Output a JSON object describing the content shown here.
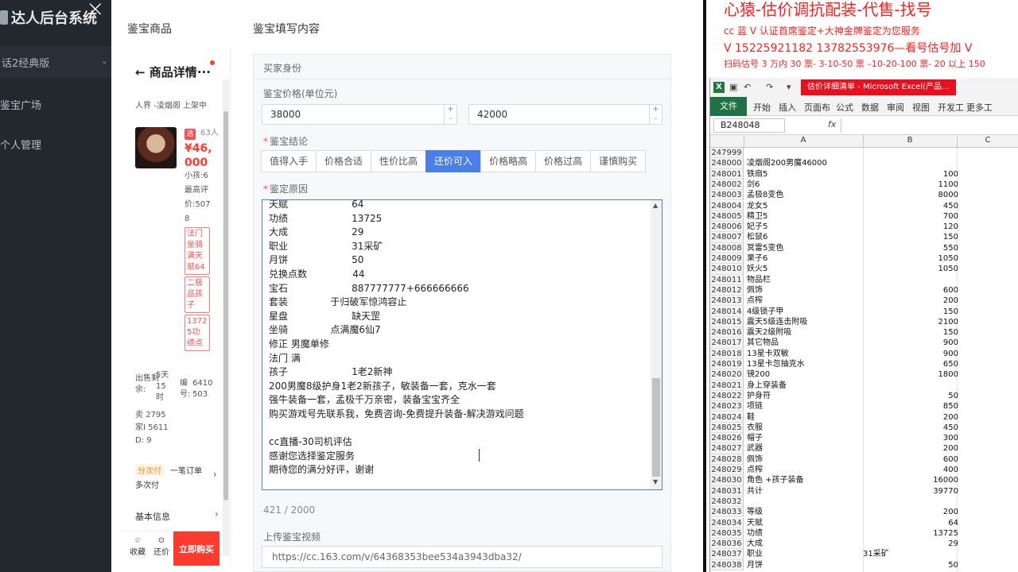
{
  "admin": {
    "logo": "达人后台系统",
    "menu_selected": "话2经典版",
    "nav": [
      "鉴宝广场",
      "个人管理"
    ]
  },
  "modal": {
    "header_left": "鉴宝商品",
    "header_right": "鉴宝填写内容"
  },
  "product": {
    "title": "商品详情",
    "title_more": "···",
    "server": "人界 -凌烟阁",
    "status": "上架中",
    "badge": "选",
    "people": "63人",
    "price_line1": "¥46,",
    "price_line2": "000",
    "meta1": "小孩:6",
    "meta2": "最高评",
    "meta3": "价:507",
    "meta4": "8",
    "pills": [
      "法门坐骑满天赋64",
      "二极品孩子",
      "13725功绩点"
    ],
    "sale_label": "出售剩余:",
    "sale_value": "5天15时",
    "code_label": "编号:",
    "code_value": "6410503",
    "stats_line1": "卖",
    "stats_line1b": "2795",
    "stats_line2": "家I",
    "stats_line2b": "5611",
    "stats_line3": "D:",
    "stats_line3b": "9",
    "pay_tag": "分次付",
    "pay_text": "一笔订单",
    "pay_text2": "多次付",
    "basic_info": "基本信息",
    "fav": "收藏",
    "bargain": "还价",
    "buy": "立即购买"
  },
  "form": {
    "section_title": "买家身份",
    "price_label": "鉴宝价格(单位元)",
    "price_min": "38000",
    "price_max": "42000",
    "conclusion_label": "鉴宝结论",
    "options": [
      "值得入手",
      "价格合适",
      "性价比高",
      "还价可入",
      "价格略高",
      "价格过高",
      "谨慎购买"
    ],
    "active_option": 3,
    "reason_label": "鉴定原因",
    "reason_lines": [
      "天赋                     64",
      "功绩                     13725",
      "大成                     29",
      "职业                     31采矿",
      "月饼                     50",
      "兑换点数               44",
      "宝石                     887777777+666666666",
      "套装              于归破军惊鸿容止",
      "星盘                     缺天罡",
      "坐骑              点满魔6仙7",
      "修正 男魔单修",
      "法门 满",
      "孩子                     1老2新神",
      "200男魔8级护身1老2新孩子，敏装备一套，克水一套",
      "强牛装备一套，孟极千万亲密，装备宝宝齐全",
      "购买游戏号先联系我，免费咨询-免费提升装备-解决游戏问题",
      "",
      "cc直播-30司机评估",
      "感谢您选择鉴定服务",
      "期待您的满分好评，谢谢"
    ],
    "counter": "421 / 2000",
    "video_label": "上传鉴宝视频",
    "video_url": "https://cc.163.com/v/64368353bee534a3943dba32/"
  },
  "promo": {
    "line1": "心猿-估价调抗配装-代售-找号",
    "line2": "cc 蓝 V 认证首席鉴定+大神金牌鉴定为您服务",
    "line3": "V 15225921182      13782553976—看号估号加 V",
    "line4": "扫码估号 3 万内 30 票- 3-10-50 票  –10-20-100 票- 20 以上 150"
  },
  "excel": {
    "doc_title": "估价详细清单 - Microsoft Excel(产品...",
    "tabs": [
      "文件",
      "开始",
      "插入",
      "页面布",
      "公式",
      "数据",
      "审阅",
      "视图",
      "开发工",
      "更多工"
    ],
    "namebox": "B248048",
    "fx": "fx",
    "columns": [
      "A",
      "B",
      "C"
    ],
    "rows": [
      {
        "n": "247999",
        "a": "",
        "b": ""
      },
      {
        "n": "248000",
        "a": "凌烟阁200男魔46000",
        "b": ""
      },
      {
        "n": "248001",
        "a": "铁扇5",
        "b": "100"
      },
      {
        "n": "248002",
        "a": "剑6",
        "b": "1100"
      },
      {
        "n": "248003",
        "a": "孟极8变色",
        "b": "8000"
      },
      {
        "n": "248004",
        "a": "龙女5",
        "b": "450"
      },
      {
        "n": "248005",
        "a": "精卫5",
        "b": "700"
      },
      {
        "n": "248006",
        "a": "妃子5",
        "b": "120"
      },
      {
        "n": "248007",
        "a": "松鼠6",
        "b": "150"
      },
      {
        "n": "248008",
        "a": "冥雷5变色",
        "b": "550"
      },
      {
        "n": "248009",
        "a": "果子6",
        "b": "1050"
      },
      {
        "n": "248010",
        "a": "妖火5",
        "b": "1050"
      },
      {
        "n": "248011",
        "a": "物品栏",
        "b": ""
      },
      {
        "n": "248012",
        "a": "佩饰",
        "b": "600"
      },
      {
        "n": "248013",
        "a": "点榨",
        "b": "200"
      },
      {
        "n": "248014",
        "a": "4级锁子甲",
        "b": "150"
      },
      {
        "n": "248015",
        "a": "震天5级连击附吸",
        "b": "2100"
      },
      {
        "n": "248016",
        "a": "震天2级附吸",
        "b": "150"
      },
      {
        "n": "248017",
        "a": "其它物品",
        "b": "900"
      },
      {
        "n": "248018",
        "a": "13星卡双敏",
        "b": "900"
      },
      {
        "n": "248019",
        "a": "13星卡忽抽克水",
        "b": "650"
      },
      {
        "n": "248020",
        "a": "镜200",
        "b": "1800"
      },
      {
        "n": "248021",
        "a": "身上穿装备",
        "b": ""
      },
      {
        "n": "248022",
        "a": "护身符",
        "b": "50"
      },
      {
        "n": "248023",
        "a": "项链",
        "b": "850"
      },
      {
        "n": "248024",
        "a": "鞋",
        "b": "200"
      },
      {
        "n": "248025",
        "a": "衣服",
        "b": "450"
      },
      {
        "n": "248026",
        "a": "帽子",
        "b": "300"
      },
      {
        "n": "248027",
        "a": "武器",
        "b": "200"
      },
      {
        "n": "248028",
        "a": "佩饰",
        "b": "600"
      },
      {
        "n": "248029",
        "a": "点榨",
        "b": "400"
      },
      {
        "n": "248030",
        "a": "角色        +孩子装备",
        "b": "16000"
      },
      {
        "n": "248031",
        "a": "共计",
        "b": "39770"
      },
      {
        "n": "248032",
        "a": "",
        "b": ""
      },
      {
        "n": "248033",
        "a": "等级",
        "b": "200"
      },
      {
        "n": "248034",
        "a": "天赋",
        "b": "64"
      },
      {
        "n": "248035",
        "a": "功绩",
        "b": "13725"
      },
      {
        "n": "248036",
        "a": "大成",
        "b": "29"
      },
      {
        "n": "248037",
        "a": "职业",
        "b": "31采矿",
        "left": true
      },
      {
        "n": "248038",
        "a": "月饼",
        "b": "50"
      }
    ]
  }
}
